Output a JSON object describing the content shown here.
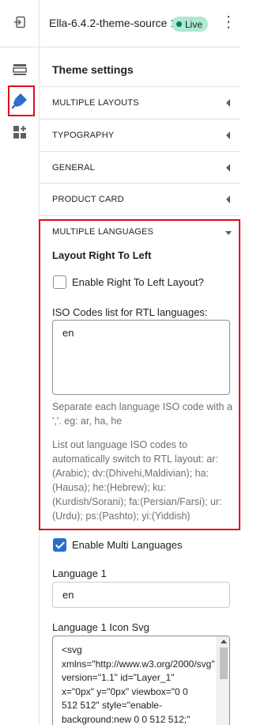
{
  "topbar": {
    "title": "Ella-6.4.2-theme-source 1",
    "status": "Live",
    "more": "⋮"
  },
  "panel": {
    "title": "Theme settings",
    "sections": [
      {
        "label": "MULTIPLE LAYOUTS",
        "expanded": false
      },
      {
        "label": "TYPOGRAPHY",
        "expanded": false
      },
      {
        "label": "GENERAL",
        "expanded": false
      },
      {
        "label": "PRODUCT CARD",
        "expanded": false
      },
      {
        "label": "MULTIPLE LANGUAGES",
        "expanded": true
      }
    ]
  },
  "multiple_languages": {
    "subheading": "Layout Right To Left",
    "rtl_checkbox_label": "Enable Right To Left Layout?",
    "rtl_checked": false,
    "iso_label": "ISO Codes list for RTL languages:",
    "iso_value": "en",
    "help1": "Separate each language ISO code with a ','. eg: ar, ha, he",
    "help2": "List out language ISO codes to automatically switch to RTL layout: ar:(Arabic); dv:(Dhivehi,Maldivian); ha:(Hausa); he:(Hebrew); ku:(Kurdish/Sorani); fa:(Persian/Farsi); ur:(Urdu); ps:(Pashto); yi:(Yiddish)",
    "multi_checkbox_label": "Enable Multi Languages",
    "multi_checked": true,
    "lang1_label": "Language 1",
    "lang1_value": "en",
    "lang1_svg_label": "Language 1 Icon Svg",
    "lang1_svg_value": "<svg\nxmlns=\"http://www.w3.org/2000/svg\" version=\"1.1\" id=\"Layer_1\"\nx=\"0px\" y=\"0px\" viewbox=\"0 0\n512 512\" style=\"enable-\nbackground:new 0 0 512 512;\""
  },
  "icons": {
    "exit": "exit-icon",
    "sections": "sections-icon",
    "theme_settings": "paint-brush-icon",
    "apps": "apps-icon"
  },
  "colors": {
    "accent": "#2c6ecb",
    "live_badge": "#aee9d1",
    "highlight": "#e00b1c"
  }
}
